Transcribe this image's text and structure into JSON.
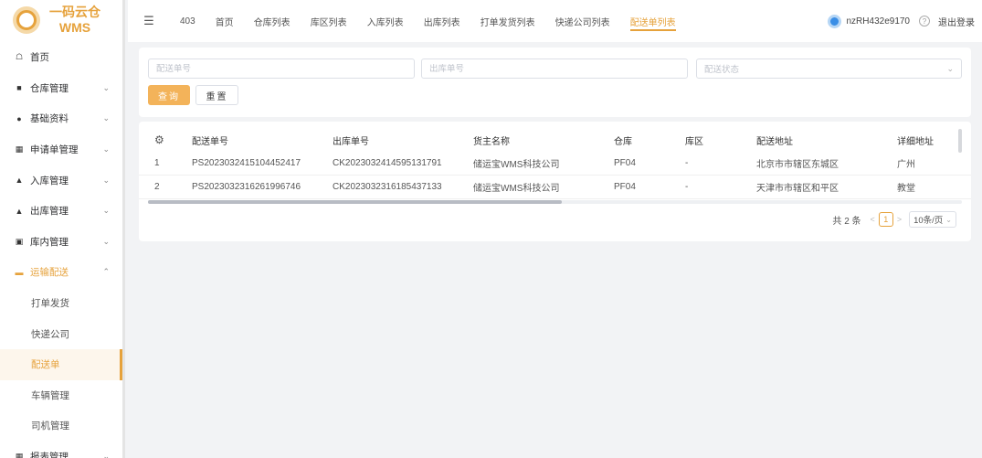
{
  "app": {
    "logo_line1": "一码云仓",
    "logo_line2": "WMS",
    "accent": "#e6a23c"
  },
  "sidebar": {
    "items": [
      {
        "label": "首页",
        "icon": "home-icon",
        "has_arrow": false
      },
      {
        "label": "仓库管理",
        "icon": "warehouse-icon",
        "has_arrow": true
      },
      {
        "label": "基础资料",
        "icon": "user-icon",
        "has_arrow": true
      },
      {
        "label": "申请单管理",
        "icon": "form-icon",
        "has_arrow": true
      },
      {
        "label": "入库管理",
        "icon": "inbound-icon",
        "has_arrow": true
      },
      {
        "label": "出库管理",
        "icon": "outbound-icon",
        "has_arrow": true
      },
      {
        "label": "库内管理",
        "icon": "inventory-icon",
        "has_arrow": true
      },
      {
        "label": "运输配送",
        "icon": "truck-icon",
        "has_arrow": true,
        "open": true
      },
      {
        "label": "打单发货",
        "sub": true
      },
      {
        "label": "快递公司",
        "sub": true
      },
      {
        "label": "配送单",
        "sub": true,
        "active": true
      },
      {
        "label": "车辆管理",
        "sub": true
      },
      {
        "label": "司机管理",
        "sub": true
      },
      {
        "label": "报表管理",
        "icon": "report-icon",
        "has_arrow": true
      }
    ]
  },
  "topbar": {
    "tabs": [
      "403",
      "首页",
      "仓库列表",
      "库区列表",
      "入库列表",
      "出库列表",
      "打单发货列表",
      "快递公司列表",
      "配送单列表"
    ],
    "active_tab": 8,
    "username": "nzRH432e9170",
    "logout": "退出登录"
  },
  "search": {
    "delivery_no_placeholder": "配送单号",
    "outbound_no_placeholder": "出库单号",
    "status_placeholder": "配送状态",
    "query_label": "查询",
    "reset_label": "重置"
  },
  "table": {
    "headers": [
      "配送单号",
      "出库单号",
      "货主名称",
      "仓库",
      "库区",
      "配送地址",
      "详细地址"
    ],
    "rows": [
      [
        "1",
        "PS2023032415104452417",
        "CK2023032414595131791",
        "储运宝WMS科技公司",
        "PF04",
        "-",
        "北京市市辖区东城区",
        "广州"
      ],
      [
        "2",
        "PS2023032316261996746",
        "CK2023032316185437133",
        "储运宝WMS科技公司",
        "PF04",
        "-",
        "天津市市辖区和平区",
        "教堂"
      ]
    ]
  },
  "pagination": {
    "total_text": "共 2 条",
    "current_page": "1",
    "page_size": "10条/页"
  }
}
